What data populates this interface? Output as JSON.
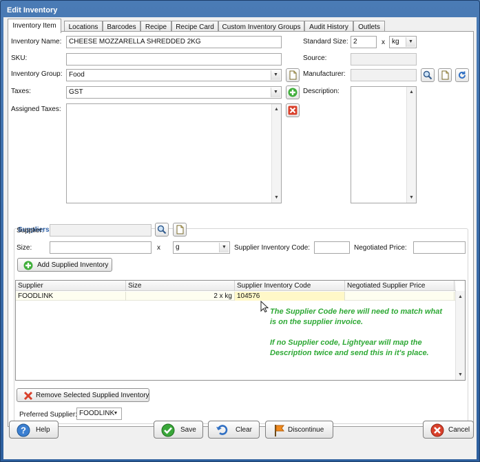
{
  "window": {
    "title": "Edit Inventory"
  },
  "tabs": [
    {
      "label": "Inventory Item",
      "active": true
    },
    {
      "label": "Locations"
    },
    {
      "label": "Barcodes"
    },
    {
      "label": "Recipe"
    },
    {
      "label": "Recipe Card"
    },
    {
      "label": "Custom Inventory Groups"
    },
    {
      "label": "Audit History"
    },
    {
      "label": "Outlets"
    }
  ],
  "item": {
    "name_label": "Inventory Name:",
    "name_value": "CHEESE MOZZARELLA SHREDDED 2KG",
    "sku_label": "SKU:",
    "sku_value": "",
    "group_label": "Inventory Group:",
    "group_value": "Food",
    "taxes_label": "Taxes:",
    "taxes_value": "GST",
    "assigned_taxes_label": "Assigned Taxes:",
    "standard_size_label": "Standard Size:",
    "standard_size_value": "2",
    "standard_size_x": "x",
    "standard_unit": "kg",
    "source_label": "Source:",
    "manufacturer_label": "Manufacturer:",
    "description_label": "Description:"
  },
  "suppliers": {
    "title": "Suppliers",
    "supplier_label": "Supplier:",
    "size_label": "Size:",
    "size_x": "x",
    "size_unit": "g",
    "code_label": "Supplier Inventory Code:",
    "price_label": "Negotiated  Price:",
    "add_button": "Add Supplied Inventory",
    "grid": {
      "columns": [
        "Supplier",
        "Size",
        "Supplier Inventory Code",
        "Negotiated Supplier Price"
      ],
      "rows": [
        {
          "supplier": "FOODLINK",
          "size": "2 x kg",
          "code": "104576",
          "price": ""
        }
      ]
    },
    "remove_button": "Remove Selected Supplied Inventory",
    "preferred_label": "Preferred Supplier:",
    "preferred_value": "FOODLINK"
  },
  "annotation": {
    "line1": "The Supplier Code here will need to match what",
    "line2": "is on the supplier invoice.",
    "line3": "If no Supplier code, Lightyear will map the",
    "line4": "Description twice and send this in it's place."
  },
  "footer": {
    "help": "Help",
    "save": "Save",
    "clear": "Clear",
    "discontinue": "Discontinue",
    "cancel": "Cancel"
  },
  "colors": {
    "title_bar": "#2d5f9e",
    "group_title": "#2a5fa8",
    "annotation": "#2da834",
    "grid_row": "#fefef0"
  }
}
